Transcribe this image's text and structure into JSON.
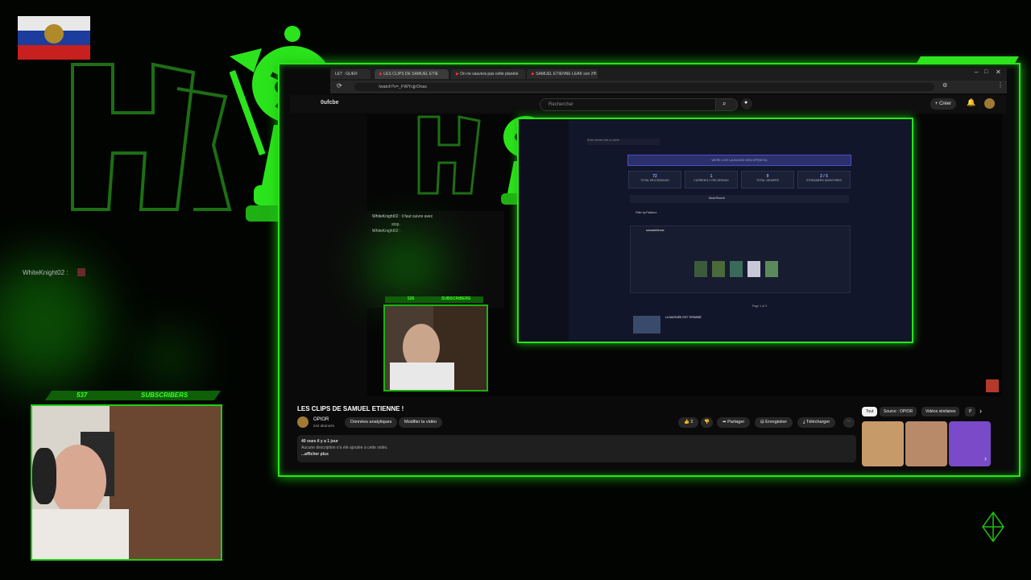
{
  "browser": {
    "tabs": [
      {
        "label": "LET : GUER"
      },
      {
        "label": "LES CLIPS DE SAMUEL ETIE"
      },
      {
        "label": "On ne sauvera pas cette planète"
      },
      {
        "label": "SAMUEL ETIENNE LEAK son 2…"
      }
    ],
    "url": "/watch?v=_FWYcjjrOnac",
    "partial_url_left": "0ufcbe"
  },
  "youtube": {
    "search_placeholder": "Rechercher",
    "create_label": "+ Créer",
    "video_title": "LES CLIPS DE SAMUEL ETIENNE !",
    "channel_name": "OPIOR",
    "channel_subs": "244 abonnés",
    "buttons": {
      "analytics": "Données analytiques",
      "edit": "Modifier la vidéo",
      "likes": "2",
      "share": "Partager",
      "save": "Enregistrer",
      "download": "Télécharger"
    },
    "description": {
      "meta": "40 vues  il y a 1 jour",
      "text": "Aucune description n'a été ajoutée à cette vidéo.",
      "more": "...afficher plus"
    },
    "chips": [
      "Tout",
      "Source : OPIOR",
      "Vidéos similaires",
      "P"
    ]
  },
  "inner_dashboard": {
    "url_hint": "Enter stream link or name",
    "banner": "WE'RE LIVE! LAUNCHED NEW APP(BETA)",
    "stats": [
      {
        "value": "72",
        "label": "TOTAL RECORDINGS"
      },
      {
        "value": "1",
        "label": "CURRENTLY RECORDING"
      },
      {
        "value": "9",
        "label": "TOTAL VIEWERS"
      },
      {
        "value": "2 / 5",
        "label": "STREAMERS MONITORED"
      }
    ],
    "filter_label": "Filter by Platform",
    "sort_label": "Most Recent",
    "streamer_name": "samuelelienne",
    "pagination": "Page 1 of 3",
    "clip_title": "LA MATINÉE EST TERMINÉ"
  },
  "overlay": {
    "sub_count_main": "537",
    "sub_label_main": "SUBSCRIBERS",
    "sub_count_small": "526",
    "sub_label_small": "SUBSCRIBERS",
    "chat_user_left": "WhiteKnight02 :",
    "chat_lines": [
      "WhiteKnight02 : il faut suivre avec",
      "stop.",
      "WhiteKnight02 :"
    ]
  },
  "colors": {
    "accent_green": "#29e31a",
    "dark_bg": "#020402",
    "yt_bg": "#0f0f0f"
  }
}
